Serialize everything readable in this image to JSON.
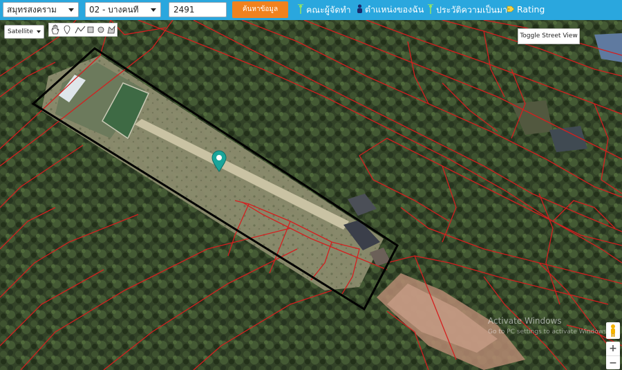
{
  "toolbar": {
    "province": "สมุทรสงคราม",
    "district": "02 - บางคนที",
    "parcel_no": "2491",
    "search_label": "ค้นหาข้อมูล",
    "links": [
      {
        "label": "คณะผู้จัดทำ",
        "icon": "antenna-icon"
      },
      {
        "label": "ตำแหน่งของฉัน",
        "icon": "person-icon"
      },
      {
        "label": "ประวัติความเป็นมา",
        "icon": "antenna-icon"
      },
      {
        "label": "Rating",
        "icon": "tag-icon"
      }
    ]
  },
  "map": {
    "type_label": "Satellite",
    "street_view_label": "Toggle Street View",
    "zoom_in": "+",
    "zoom_out": "−",
    "watermark_title": "Activate Windows",
    "watermark_text": "Go to PC settings to activate Windows."
  },
  "colors": {
    "toolbar": "#2aa7de",
    "search_button": "#f0821e",
    "parcel_lines": "#d41f1f",
    "selected_outline": "#000000",
    "marker": "#1aa59a"
  }
}
